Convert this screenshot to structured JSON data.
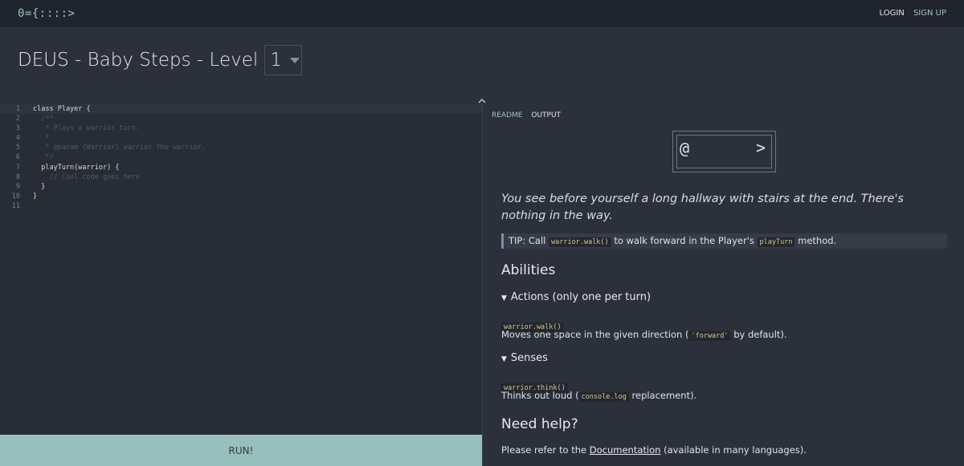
{
  "nav": {
    "logo": "0={::::>",
    "login": "LOGIN",
    "signup": "SIGN UP"
  },
  "header": {
    "title": "DEUS - Baby Steps - Level",
    "level": "1"
  },
  "editor": {
    "lines": [
      {
        "num": "1",
        "text": "class Player {"
      },
      {
        "num": "2",
        "text": "  /**"
      },
      {
        "num": "3",
        "text": "   * Plays a warrior turn."
      },
      {
        "num": "4",
        "text": "   *"
      },
      {
        "num": "5",
        "text": "   * @param {Warrior} warrior The warrior."
      },
      {
        "num": "6",
        "text": "   */"
      },
      {
        "num": "7",
        "text": "  playTurn(warrior) {"
      },
      {
        "num": "8",
        "text": "    // Cool code goes here"
      },
      {
        "num": "9",
        "text": "  }"
      },
      {
        "num": "10",
        "text": "}"
      },
      {
        "num": "11",
        "text": ""
      }
    ],
    "run_label": "RUN!"
  },
  "panel": {
    "tabs": {
      "readme": "README",
      "output": "OUTPUT"
    },
    "board": {
      "warrior": "@",
      "stairs": ">"
    },
    "description": "You see before yourself a long hallway with stairs at the end. There's nothing in the way.",
    "tip": {
      "prefix": "TIP: Call",
      "code1": "warrior.walk()",
      "middle": "to walk forward in the Player's",
      "code2": "playTurn",
      "suffix": "method."
    },
    "abilities_title": "Abilities",
    "actions": {
      "title": "Actions (only one per turn)",
      "api": "warrior.walk()",
      "desc_prefix": "Moves one space in the given direction (",
      "desc_code": "'forward'",
      "desc_suffix": "by default)."
    },
    "senses": {
      "title": "Senses",
      "api": "warrior.think()",
      "desc_prefix": "Thinks out loud (",
      "desc_code": "console.log",
      "desc_suffix": "replacement)."
    },
    "help": {
      "title": "Need help?",
      "prefix": "Please refer to the",
      "link": "Documentation",
      "suffix": "(available in many languages)."
    }
  }
}
